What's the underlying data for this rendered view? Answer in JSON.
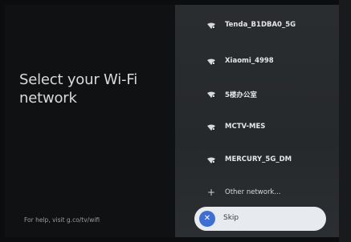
{
  "title": "Select your Wi-Fi network",
  "help_text": "For help, visit g.co/tv/wifi",
  "networks": [
    {
      "name": "Tenda_B1DBA0_5G",
      "icon": "wifi-locked-icon"
    },
    {
      "name": "Xiaomi_4998",
      "icon": "wifi-locked-icon"
    },
    {
      "name": "5楼办公室",
      "icon": "wifi-locked-icon"
    },
    {
      "name": "MCTV-MES",
      "icon": "wifi-locked-icon"
    },
    {
      "name": "MERCURY_5G_DM",
      "icon": "wifi-locked-icon"
    }
  ],
  "other_network": {
    "label": "Other network...",
    "icon": "plus-icon"
  },
  "skip": {
    "label": "Skip",
    "icon": "close-icon"
  },
  "colors": {
    "accent": "#3e6ed1",
    "panel": "#2a2d30",
    "background": "#101112"
  }
}
